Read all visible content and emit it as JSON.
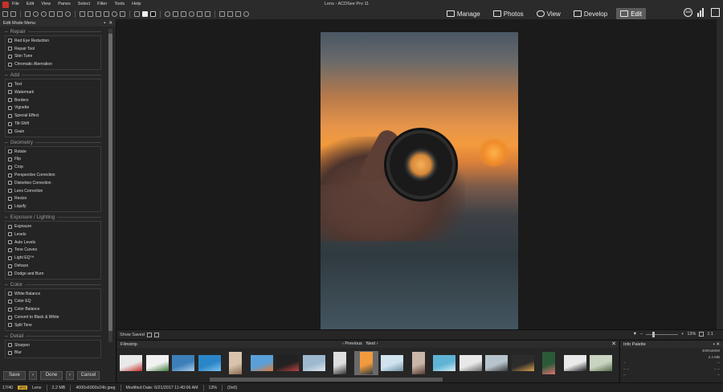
{
  "window": {
    "title": "Lens - ACDSee Pro 11"
  },
  "menu": [
    "File",
    "Edit",
    "View",
    "Panes",
    "Select",
    "Filter",
    "Tools",
    "Help"
  ],
  "modes": {
    "manage": "Manage",
    "photos": "Photos",
    "view": "View",
    "develop": "Develop",
    "edit": "Edit"
  },
  "user_badge": "365",
  "left_panel": {
    "title": "Edit Mode Menu",
    "sections": [
      {
        "title": "Repair",
        "items": [
          "Red Eye Reduction",
          "Repair Tool",
          "Skin Tune",
          "Chromatic Aberration"
        ]
      },
      {
        "title": "Add",
        "items": [
          "Text",
          "Watermark",
          "Borders",
          "Vignette",
          "Special Effect",
          "Tilt-Shift",
          "Grain"
        ]
      },
      {
        "title": "Geometry",
        "items": [
          "Rotate",
          "Flip",
          "Crop",
          "Perspective Correction",
          "Distortion Correction",
          "Lens Correction",
          "Resize",
          "Liquify"
        ]
      },
      {
        "title": "Exposure / Lighting",
        "items": [
          "Exposure",
          "Levels",
          "Auto Levels",
          "Tone Curves",
          "Light EQ™",
          "Dehaze",
          "Dodge and Burn"
        ]
      },
      {
        "title": "Color",
        "items": [
          "White Balance",
          "Color EQ",
          "Color Balance",
          "Convert to Black & White",
          "Split Tone"
        ]
      },
      {
        "title": "Detail",
        "items": [
          "Sharpen",
          "Blur"
        ]
      }
    ],
    "buttons": {
      "save": "Save",
      "done": "Done",
      "cancel": "Cancel"
    }
  },
  "viewer": {
    "show_saved": "Show Saved",
    "zoom": "13%",
    "ratio": "1:1"
  },
  "filmstrip": {
    "title": "Filmstrip",
    "previous": "Previous",
    "next": "Next",
    "close": "✕",
    "selected_index": 9,
    "thumbs": [
      {
        "c1": "#e9e9e9",
        "c2": "#c8302a",
        "tall": false
      },
      {
        "c1": "#f1f1f1",
        "c2": "#3e7a3a",
        "tall": false
      },
      {
        "c1": "#3d7fb9",
        "c2": "#a9cdea",
        "tall": false
      },
      {
        "c1": "#2a86c8",
        "c2": "#7fc2ee",
        "tall": false
      },
      {
        "c1": "#d8c3ad",
        "c2": "#8a6a50",
        "tall": true
      },
      {
        "c1": "#5aa0d8",
        "c2": "#e07b3a",
        "tall": false
      },
      {
        "c1": "#222222",
        "c2": "#c04040",
        "tall": false
      },
      {
        "c1": "#9eb9cf",
        "c2": "#e1e8ee",
        "tall": false
      },
      {
        "c1": "#dedede",
        "c2": "#333333",
        "tall": true
      },
      {
        "c1": "#f09a3e",
        "c2": "#2f3a3f",
        "tall": true
      },
      {
        "c1": "#cfe3ee",
        "c2": "#6b8fa3",
        "tall": false
      },
      {
        "c1": "#c9b6a8",
        "c2": "#553a33",
        "tall": true
      },
      {
        "c1": "#5fb4d6",
        "c2": "#d9eef5",
        "tall": false
      },
      {
        "c1": "#e8e8e8",
        "c2": "#6d6d6d",
        "tall": false
      },
      {
        "c1": "#b8c4cc",
        "c2": "#3a3a3a",
        "tall": false
      },
      {
        "c1": "#2c2c2c",
        "c2": "#d8a24a",
        "tall": false
      },
      {
        "c1": "#2a5a38",
        "c2": "#e07070",
        "tall": true
      },
      {
        "c1": "#eaeaea",
        "c2": "#222222",
        "tall": false
      },
      {
        "c1": "#c8d4c0",
        "c2": "#556b4a",
        "tall": false
      }
    ]
  },
  "info_palette": {
    "title": "Info Palette",
    "rows": [
      {
        "l": "",
        "r": "4000x6000"
      },
      {
        "l": "",
        "r": "2.2 MB"
      },
      {
        "l": "--",
        "r": "--"
      },
      {
        "l": "--   --",
        "r": "--   --"
      },
      {
        "l": "--",
        "r": "--"
      }
    ]
  },
  "status": {
    "position": "17/40",
    "format_badge": "JPG",
    "filename": "Lens",
    "filesize": "2.2 MB",
    "dimensions": "4000x6000x24b jpeg",
    "modified": "Modified Date: 6/21/2017 11:40:06 AM",
    "zoom": "13%",
    "coords": "(0x0)"
  }
}
